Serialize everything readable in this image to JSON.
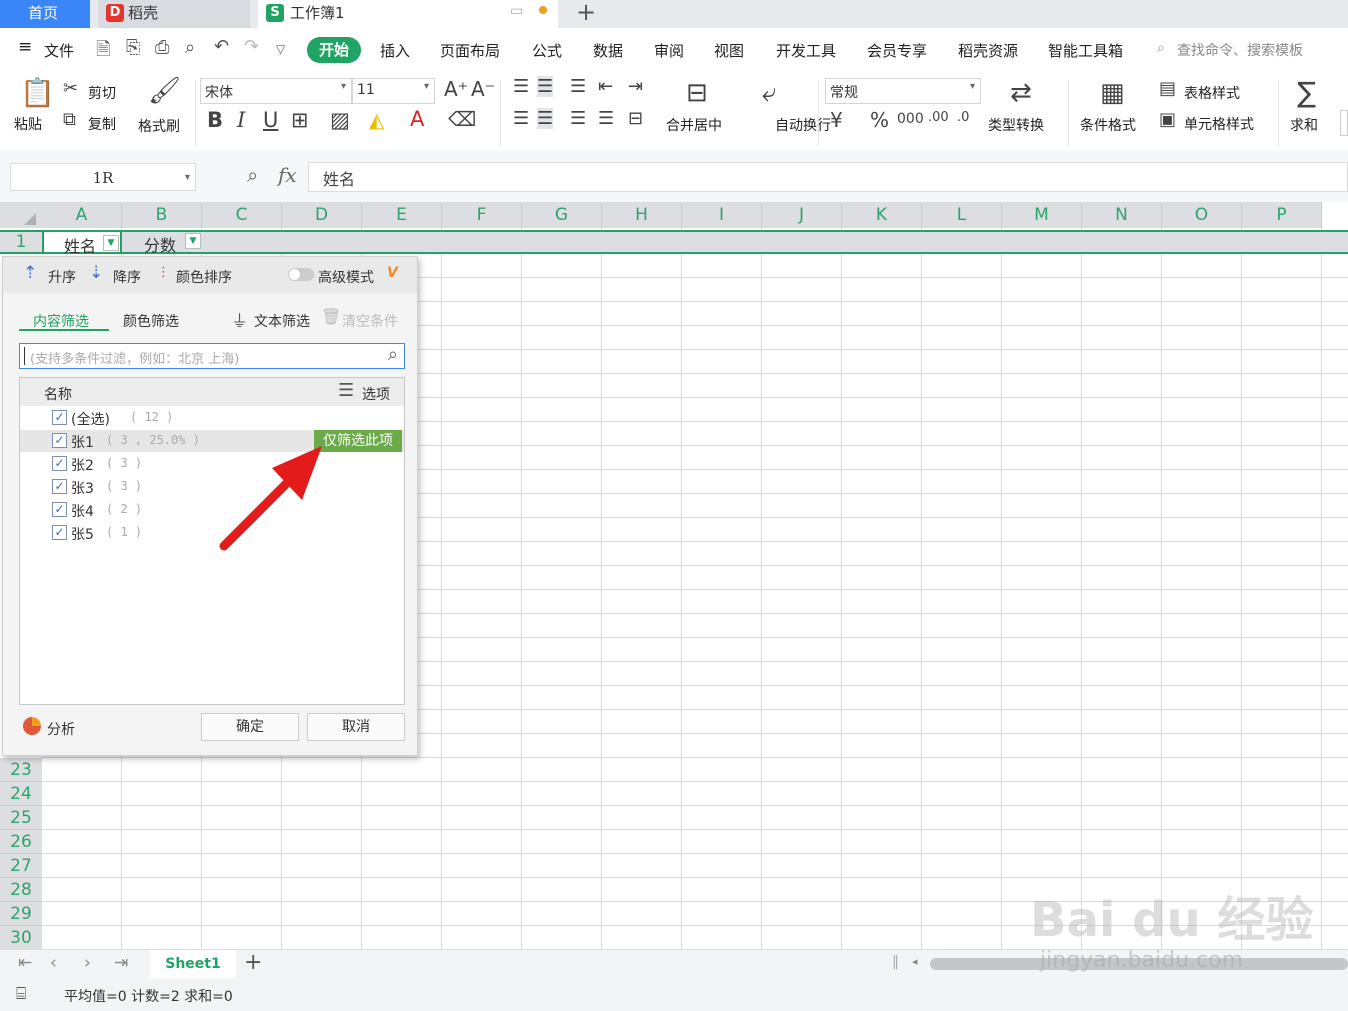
{
  "tabs": {
    "home": "首页",
    "docer": "稻壳",
    "workbook": "工作簿1",
    "workbook_icon": "S",
    "docer_icon": "D"
  },
  "menu": {
    "file": "文件",
    "start": "开始",
    "insert": "插入",
    "layout": "页面布局",
    "formula": "公式",
    "data": "数据",
    "review": "审阅",
    "view": "视图",
    "dev": "开发工具",
    "vip": "会员专享",
    "docer": "稻壳资源",
    "smart": "智能工具箱",
    "search": "查找命令、搜索模板"
  },
  "ribbon": {
    "paste": "粘贴",
    "cut": "剪切",
    "copy": "复制",
    "painter": "格式刷",
    "font": "宋体",
    "size": "11",
    "merge": "合并居中",
    "wrap": "自动换行",
    "numfmt": "常规",
    "convert": "类型转换",
    "cond": "条件格式",
    "tablestyle": "表格样式",
    "cellstyle": "单元格样式",
    "sum": "求和"
  },
  "formula": {
    "namebox": "1R",
    "fx": "fx",
    "content": "姓名"
  },
  "columns": [
    "A",
    "B",
    "C",
    "D",
    "E",
    "F",
    "G",
    "H",
    "I",
    "J",
    "K",
    "L",
    "M",
    "N",
    "O",
    "P"
  ],
  "row1": {
    "num": "1",
    "a": "姓名",
    "b": "分数"
  },
  "rows": [
    "23",
    "24",
    "25",
    "26",
    "27",
    "28",
    "29",
    "30"
  ],
  "filter": {
    "sort_asc": "升序",
    "sort_desc": "降序",
    "sort_color": "颜色排序",
    "advanced": "高级模式",
    "tab_content": "内容筛选",
    "tab_color": "颜色筛选",
    "text_filter": "文本筛选",
    "clear": "清空条件",
    "search_placeholder": "(支持多条件过滤，例如：北京 上海)",
    "list_header": "名称",
    "options": "选项",
    "items": [
      {
        "label": "(全选)",
        "count": "( 12 )"
      },
      {
        "label": "张1",
        "count": "( 3 , 25.0% )"
      },
      {
        "label": "张2",
        "count": "( 3 )"
      },
      {
        "label": "张3",
        "count": "( 3 )"
      },
      {
        "label": "张4",
        "count": "( 2 )"
      },
      {
        "label": "张5",
        "count": "( 1 )"
      }
    ],
    "only_this": "仅筛选此项",
    "analyze": "分析",
    "ok": "确定",
    "cancel": "取消"
  },
  "sheet": {
    "name": "Sheet1",
    "add": "+"
  },
  "status": {
    "text": "平均值=0 计数=2 求和=0"
  },
  "watermark": {
    "brand": "Bai du 经验",
    "url": "jingyan.baidu.com"
  },
  "colors": {
    "accent": "#1fa463",
    "home_tab": "#3b86f7",
    "grid_header": "#dcdee2",
    "only_btn": "#6aaa49",
    "arrow": "#e41b1b"
  }
}
